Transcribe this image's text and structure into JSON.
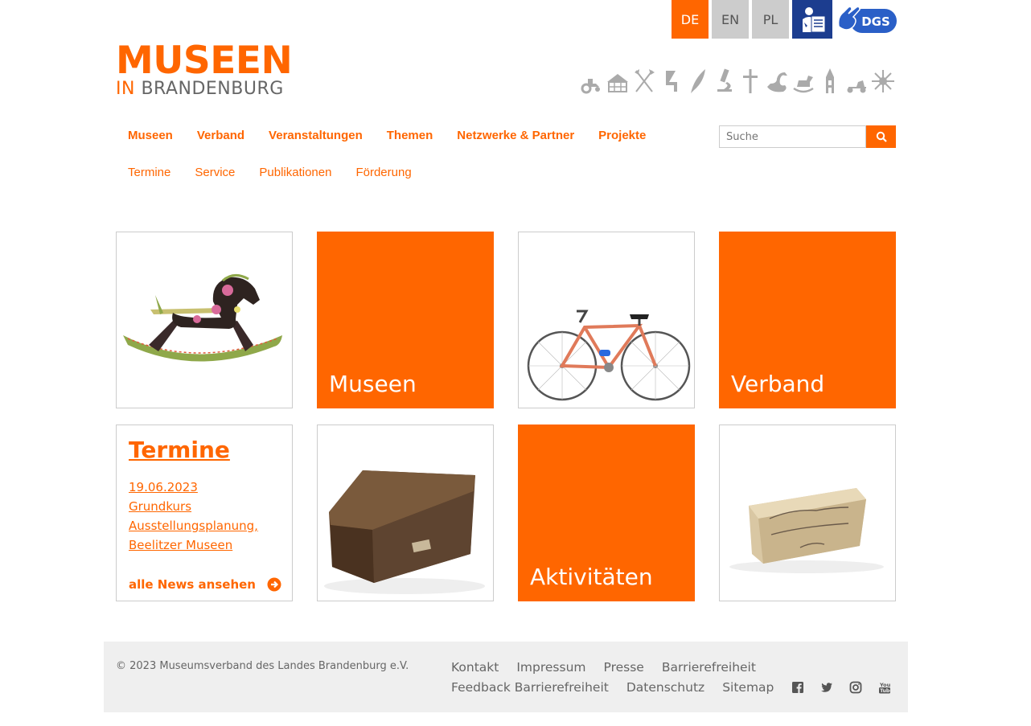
{
  "languages": [
    {
      "label": "DE",
      "active": true
    },
    {
      "label": "EN",
      "active": false
    },
    {
      "label": "PL",
      "active": false
    }
  ],
  "dgs_label": "DGS",
  "logo": {
    "line1": "MUSEEN",
    "in": "IN",
    "line2": "BRANDENBURG"
  },
  "theme_icons": [
    "tractor-icon",
    "farmhouse-icon",
    "tools-icon",
    "chair-icon",
    "feather-icon",
    "microscope-icon",
    "cross-icon",
    "duck-icon",
    "rocking-horse-icon",
    "church-icon",
    "scooter-icon",
    "sun-icon"
  ],
  "nav_main": [
    "Museen",
    "Verband",
    "Veranstaltungen",
    "Themen",
    "Netzwerke & Partner",
    "Projekte"
  ],
  "nav_sub": [
    "Termine",
    "Service",
    "Publikationen",
    "Förderung"
  ],
  "search": {
    "placeholder": "Suche"
  },
  "tiles": {
    "museen": "Museen",
    "verband": "Verband",
    "aktivitaeten": "Aktivitäten"
  },
  "termine": {
    "title": "Termine",
    "entry_date": "19.06.2023",
    "entry_line1": "Grundkurs",
    "entry_line2": "Ausstellungsplanung,",
    "entry_line3": "Beelitzer Museen",
    "more": "alle News ansehen"
  },
  "footer": {
    "copyright": "© 2023 Museumsverband des Landes Brandenburg e.V.",
    "links1": [
      "Kontakt",
      "Impressum",
      "Presse",
      "Barrierefreiheit"
    ],
    "links2": [
      "Feedback Barrierefreiheit",
      "Datenschutz",
      "Sitemap"
    ],
    "social": [
      "facebook-icon",
      "twitter-icon",
      "instagram-icon",
      "youtube-icon"
    ]
  },
  "colors": {
    "accent": "#ff6600",
    "grey": "#cccccc",
    "footer_bg": "#efefef",
    "easy_bg": "#1c3d8f"
  }
}
